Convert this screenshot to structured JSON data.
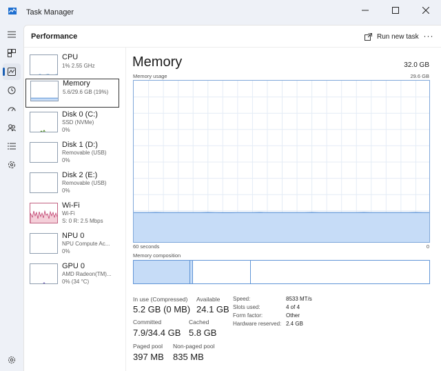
{
  "window": {
    "title": "Task Manager"
  },
  "header": {
    "page_title": "Performance",
    "run_new_task": "Run new task",
    "more": "···"
  },
  "devices": [
    {
      "name": "CPU",
      "line1": "1%  2.55 GHz",
      "line2": ""
    },
    {
      "name": "Memory",
      "line1": "5.6/29.6 GB (19%)",
      "line2": ""
    },
    {
      "name": "Disk 0 (C:)",
      "line1": "SSD (NVMe)",
      "line2": "0%"
    },
    {
      "name": "Disk 1 (D:)",
      "line1": "Removable (USB)",
      "line2": "0%"
    },
    {
      "name": "Disk 2 (E:)",
      "line1": "Removable (USB)",
      "line2": "0%"
    },
    {
      "name": "Wi-Fi",
      "line1": "Wi-Fi",
      "line2": "S: 0  R: 2.5 Mbps"
    },
    {
      "name": "NPU 0",
      "line1": "NPU Compute Ac...",
      "line2": "0%"
    },
    {
      "name": "GPU 0",
      "line1": "AMD Radeon(TM)...",
      "line2": "0%  (34 °C)"
    }
  ],
  "detail": {
    "title": "Memory",
    "total": "32.0 GB",
    "usage_label": "Memory usage",
    "usage_max": "29.6 GB",
    "time_left": "60 seconds",
    "time_right": "0",
    "composition_label": "Memory composition",
    "usage_fraction": 0.19,
    "composition": {
      "in_use_fraction": 0.19,
      "modified_fraction": 0.01,
      "standby_fraction": 0.196
    },
    "stats": {
      "in_use_label": "In use (Compressed)",
      "in_use_value": "5.2 GB (0 MB)",
      "available_label": "Available",
      "available_value": "24.1 GB",
      "committed_label": "Committed",
      "committed_value": "7.9/34.4 GB",
      "cached_label": "Cached",
      "cached_value": "5.8 GB",
      "paged_label": "Paged pool",
      "paged_value": "397 MB",
      "nonpaged_label": "Non-paged pool",
      "nonpaged_value": "835 MB"
    },
    "hardware": {
      "speed_label": "Speed:",
      "speed_value": "8533 MT/s",
      "slots_label": "Slots used:",
      "slots_value": "4 of 4",
      "form_label": "Form factor:",
      "form_value": "Other",
      "reserved_label": "Hardware reserved:",
      "reserved_value": "2.4 GB"
    }
  },
  "colors": {
    "accent": "#1a5fb4",
    "memory_fill": "#c6dcf7",
    "memory_line": "#5f94d6",
    "wifi_fill": "#f4cfd9",
    "wifi_line": "#c0406e"
  },
  "icons": [
    "hamburger-icon",
    "processes-icon",
    "performance-icon",
    "app-history-icon",
    "startup-apps-icon",
    "users-icon",
    "details-icon",
    "services-icon",
    "settings-icon"
  ]
}
